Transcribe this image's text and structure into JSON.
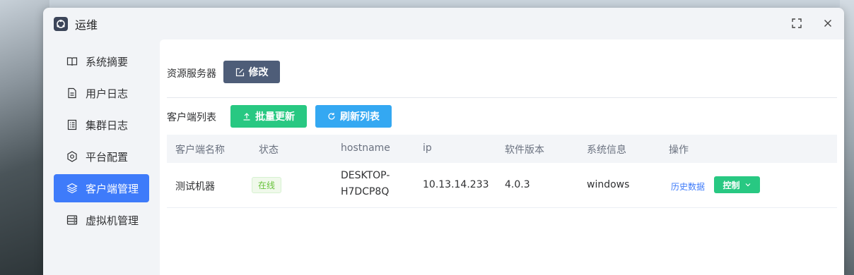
{
  "window": {
    "title": "运维"
  },
  "sidebar": {
    "items": [
      {
        "label": "系统摘要",
        "icon": "book-icon"
      },
      {
        "label": "用户日志",
        "icon": "document-icon"
      },
      {
        "label": "集群日志",
        "icon": "list-document-icon"
      },
      {
        "label": "平台配置",
        "icon": "hexagon-settings-icon"
      },
      {
        "label": "客户端管理",
        "icon": "layers-icon",
        "active": true
      },
      {
        "label": "虚拟机管理",
        "icon": "server-icon"
      }
    ]
  },
  "resource_server": {
    "label": "资源服务器",
    "edit_button": "修改"
  },
  "client_list": {
    "label": "客户端列表",
    "batch_update_button": "批量更新",
    "refresh_button": "刷新列表",
    "columns": [
      "客户端名称",
      "状态",
      "hostname",
      "ip",
      "软件版本",
      "系统信息",
      "操作"
    ],
    "rows": [
      {
        "name": "测试机器",
        "status": "在线",
        "hostname_line1": "DESKTOP-",
        "hostname_line2": "H7DCP8Q",
        "ip": "10.13.14.233",
        "version": "4.0.3",
        "os": "windows",
        "history_link": "历史数据",
        "control_button": "控制"
      }
    ]
  },
  "colors": {
    "accent": "#3e7bfa",
    "success": "#28c882",
    "info": "#34a8f2",
    "edit": "#4e5d78"
  }
}
